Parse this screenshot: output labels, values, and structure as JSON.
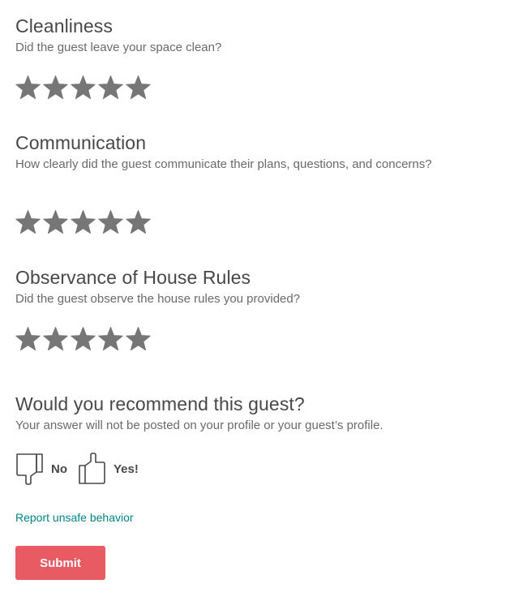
{
  "colors": {
    "star": "#767676",
    "heading": "#484848",
    "subtext": "#6a6a6a",
    "link": "#008489",
    "submit_bg": "#e85b63",
    "submit_text": "#ffffff",
    "thumb_outline": "#484848"
  },
  "cleanliness": {
    "title": "Cleanliness",
    "question": "Did the guest leave your space clean?",
    "rating": 5,
    "max_rating": 5
  },
  "communication": {
    "title": "Communication",
    "question": "How clearly did the guest communicate their plans, questions, and concerns?",
    "rating": 5,
    "max_rating": 5
  },
  "house_rules": {
    "title": "Observance of House Rules",
    "question": "Did the guest observe the house rules you provided?",
    "rating": 5,
    "max_rating": 5
  },
  "recommend": {
    "title": "Would you recommend this guest?",
    "note": "Your answer will not be posted on your profile or your guest’s profile.",
    "no_label": "No",
    "yes_label": "Yes!",
    "no_icon": "thumbs-down-icon",
    "yes_icon": "thumbs-up-icon"
  },
  "report_link": "Report unsafe behavior",
  "submit_label": "Submit"
}
